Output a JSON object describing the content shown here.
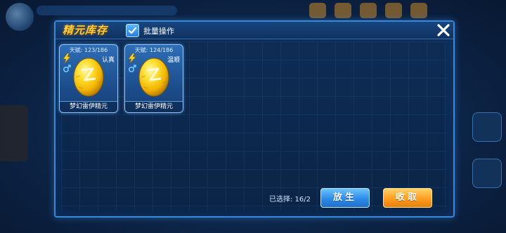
{
  "panel": {
    "title": "精元库存",
    "batch_label": "批量操作",
    "batch_checked": true
  },
  "cards": [
    {
      "talent": "天赋: 123/186",
      "nature": "认真",
      "name": "梦幻雷伊精元",
      "gender": "male"
    },
    {
      "talent": "天赋: 124/186",
      "nature": "温顺",
      "name": "梦幻雷伊精元",
      "gender": "male"
    }
  ],
  "footer": {
    "selected_label": "已选择: 16/2",
    "release_label": "放生",
    "cancel_label": "收取"
  },
  "colors": {
    "title": "#ffcf3a",
    "panel_border": "#3b88d8",
    "release_button": "#2c8be8",
    "cancel_button": "#ff9e1f"
  },
  "icons": [
    "check-icon",
    "close-icon",
    "lightning-icon",
    "male-gender-icon",
    "golden-egg-icon"
  ]
}
